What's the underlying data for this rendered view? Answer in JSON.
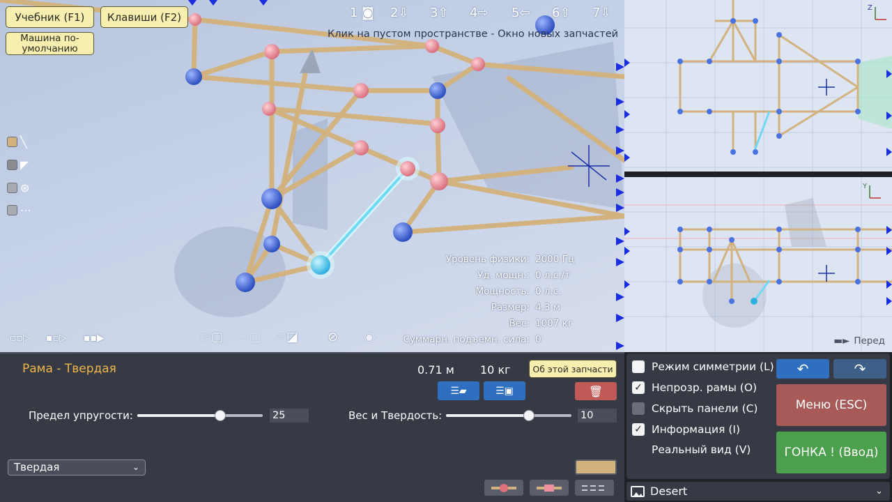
{
  "top_buttons": {
    "tutorial": "Учебник (F1)",
    "keys": "Клавиши (F2)",
    "default_car": "Машина по-умолчанию"
  },
  "camera_views": [
    "1",
    "2",
    "3",
    "4",
    "5",
    "6",
    "7"
  ],
  "hint": "Клик на пустом пространстве - Окно новых запчастей",
  "stats": [
    {
      "label": "Уровень физики:",
      "value": "2000 Гц"
    },
    {
      "label": "Уд. мощн.:",
      "value": "0 л.с./т"
    },
    {
      "label": "Мощность:",
      "value": "0 л.с."
    },
    {
      "label": "Размер:",
      "value": "4.3 м"
    },
    {
      "label": "Вес:",
      "value": "1007 кг"
    },
    {
      "label": "Суммарн. подъемн. сила:",
      "value": "0"
    }
  ],
  "front_label": "Перед",
  "part": {
    "title": "Рама - Твердая",
    "length": "0.71 м",
    "weight": "10 кг",
    "about_label": "Об этой запчасти",
    "elasticity_label": "Предел упругости:",
    "elasticity_value": "25",
    "elasticity_fraction": 0.66,
    "weight_hardness_label": "Вес и Твердость:",
    "weight_hardness_value": "10",
    "weight_hardness_fraction": 0.66,
    "material": "Твердая",
    "color": "#d2b27f"
  },
  "settings": {
    "options": [
      {
        "label": "Режим симметрии (L)",
        "checked": false
      },
      {
        "label": "Непрозр. рамы (O)",
        "checked": true
      },
      {
        "label": "Скрыть панели (C)",
        "checked": false
      },
      {
        "label": "Информация (I)",
        "checked": true
      },
      {
        "label": "Реальный вид (V)",
        "checked": null
      }
    ],
    "menu_label": "Меню (ESC)",
    "race_label": "ГОНКА ! (Ввод)",
    "environment": "Desert"
  },
  "colors": {
    "frame": "#d2b27f",
    "node_blue": "#4a72e0",
    "node_pink": "#f0909c",
    "selected": "#6fd8f4",
    "menu": "#a85a58",
    "race": "#4c9f4c",
    "accent_blue": "#2f6fc0",
    "title_orange": "#f2b64a"
  }
}
